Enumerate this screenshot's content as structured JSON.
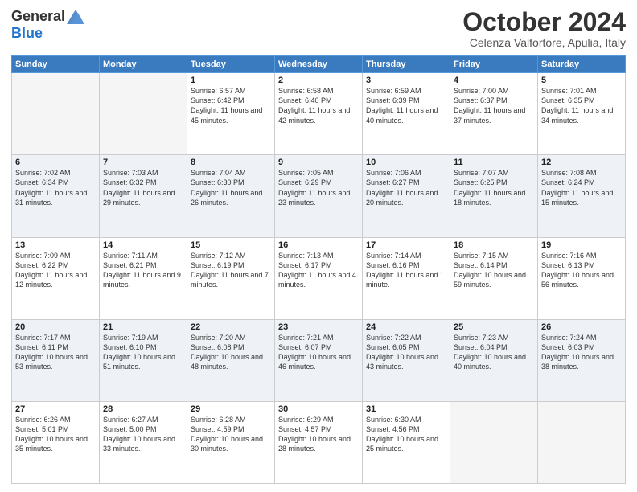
{
  "header": {
    "logo_general": "General",
    "logo_blue": "Blue",
    "month_title": "October 2024",
    "subtitle": "Celenza Valfortore, Apulia, Italy"
  },
  "days_of_week": [
    "Sunday",
    "Monday",
    "Tuesday",
    "Wednesday",
    "Thursday",
    "Friday",
    "Saturday"
  ],
  "weeks": [
    [
      {
        "day": "",
        "sunrise": "",
        "sunset": "",
        "daylight": "",
        "empty": true
      },
      {
        "day": "",
        "sunrise": "",
        "sunset": "",
        "daylight": "",
        "empty": true
      },
      {
        "day": "1",
        "sunrise": "Sunrise: 6:57 AM",
        "sunset": "Sunset: 6:42 PM",
        "daylight": "Daylight: 11 hours and 45 minutes."
      },
      {
        "day": "2",
        "sunrise": "Sunrise: 6:58 AM",
        "sunset": "Sunset: 6:40 PM",
        "daylight": "Daylight: 11 hours and 42 minutes."
      },
      {
        "day": "3",
        "sunrise": "Sunrise: 6:59 AM",
        "sunset": "Sunset: 6:39 PM",
        "daylight": "Daylight: 11 hours and 40 minutes."
      },
      {
        "day": "4",
        "sunrise": "Sunrise: 7:00 AM",
        "sunset": "Sunset: 6:37 PM",
        "daylight": "Daylight: 11 hours and 37 minutes."
      },
      {
        "day": "5",
        "sunrise": "Sunrise: 7:01 AM",
        "sunset": "Sunset: 6:35 PM",
        "daylight": "Daylight: 11 hours and 34 minutes."
      }
    ],
    [
      {
        "day": "6",
        "sunrise": "Sunrise: 7:02 AM",
        "sunset": "Sunset: 6:34 PM",
        "daylight": "Daylight: 11 hours and 31 minutes."
      },
      {
        "day": "7",
        "sunrise": "Sunrise: 7:03 AM",
        "sunset": "Sunset: 6:32 PM",
        "daylight": "Daylight: 11 hours and 29 minutes."
      },
      {
        "day": "8",
        "sunrise": "Sunrise: 7:04 AM",
        "sunset": "Sunset: 6:30 PM",
        "daylight": "Daylight: 11 hours and 26 minutes."
      },
      {
        "day": "9",
        "sunrise": "Sunrise: 7:05 AM",
        "sunset": "Sunset: 6:29 PM",
        "daylight": "Daylight: 11 hours and 23 minutes."
      },
      {
        "day": "10",
        "sunrise": "Sunrise: 7:06 AM",
        "sunset": "Sunset: 6:27 PM",
        "daylight": "Daylight: 11 hours and 20 minutes."
      },
      {
        "day": "11",
        "sunrise": "Sunrise: 7:07 AM",
        "sunset": "Sunset: 6:25 PM",
        "daylight": "Daylight: 11 hours and 18 minutes."
      },
      {
        "day": "12",
        "sunrise": "Sunrise: 7:08 AM",
        "sunset": "Sunset: 6:24 PM",
        "daylight": "Daylight: 11 hours and 15 minutes."
      }
    ],
    [
      {
        "day": "13",
        "sunrise": "Sunrise: 7:09 AM",
        "sunset": "Sunset: 6:22 PM",
        "daylight": "Daylight: 11 hours and 12 minutes."
      },
      {
        "day": "14",
        "sunrise": "Sunrise: 7:11 AM",
        "sunset": "Sunset: 6:21 PM",
        "daylight": "Daylight: 11 hours and 9 minutes."
      },
      {
        "day": "15",
        "sunrise": "Sunrise: 7:12 AM",
        "sunset": "Sunset: 6:19 PM",
        "daylight": "Daylight: 11 hours and 7 minutes."
      },
      {
        "day": "16",
        "sunrise": "Sunrise: 7:13 AM",
        "sunset": "Sunset: 6:17 PM",
        "daylight": "Daylight: 11 hours and 4 minutes."
      },
      {
        "day": "17",
        "sunrise": "Sunrise: 7:14 AM",
        "sunset": "Sunset: 6:16 PM",
        "daylight": "Daylight: 11 hours and 1 minute."
      },
      {
        "day": "18",
        "sunrise": "Sunrise: 7:15 AM",
        "sunset": "Sunset: 6:14 PM",
        "daylight": "Daylight: 10 hours and 59 minutes."
      },
      {
        "day": "19",
        "sunrise": "Sunrise: 7:16 AM",
        "sunset": "Sunset: 6:13 PM",
        "daylight": "Daylight: 10 hours and 56 minutes."
      }
    ],
    [
      {
        "day": "20",
        "sunrise": "Sunrise: 7:17 AM",
        "sunset": "Sunset: 6:11 PM",
        "daylight": "Daylight: 10 hours and 53 minutes."
      },
      {
        "day": "21",
        "sunrise": "Sunrise: 7:19 AM",
        "sunset": "Sunset: 6:10 PM",
        "daylight": "Daylight: 10 hours and 51 minutes."
      },
      {
        "day": "22",
        "sunrise": "Sunrise: 7:20 AM",
        "sunset": "Sunset: 6:08 PM",
        "daylight": "Daylight: 10 hours and 48 minutes."
      },
      {
        "day": "23",
        "sunrise": "Sunrise: 7:21 AM",
        "sunset": "Sunset: 6:07 PM",
        "daylight": "Daylight: 10 hours and 46 minutes."
      },
      {
        "day": "24",
        "sunrise": "Sunrise: 7:22 AM",
        "sunset": "Sunset: 6:05 PM",
        "daylight": "Daylight: 10 hours and 43 minutes."
      },
      {
        "day": "25",
        "sunrise": "Sunrise: 7:23 AM",
        "sunset": "Sunset: 6:04 PM",
        "daylight": "Daylight: 10 hours and 40 minutes."
      },
      {
        "day": "26",
        "sunrise": "Sunrise: 7:24 AM",
        "sunset": "Sunset: 6:03 PM",
        "daylight": "Daylight: 10 hours and 38 minutes."
      }
    ],
    [
      {
        "day": "27",
        "sunrise": "Sunrise: 6:26 AM",
        "sunset": "Sunset: 5:01 PM",
        "daylight": "Daylight: 10 hours and 35 minutes."
      },
      {
        "day": "28",
        "sunrise": "Sunrise: 6:27 AM",
        "sunset": "Sunset: 5:00 PM",
        "daylight": "Daylight: 10 hours and 33 minutes."
      },
      {
        "day": "29",
        "sunrise": "Sunrise: 6:28 AM",
        "sunset": "Sunset: 4:59 PM",
        "daylight": "Daylight: 10 hours and 30 minutes."
      },
      {
        "day": "30",
        "sunrise": "Sunrise: 6:29 AM",
        "sunset": "Sunset: 4:57 PM",
        "daylight": "Daylight: 10 hours and 28 minutes."
      },
      {
        "day": "31",
        "sunrise": "Sunrise: 6:30 AM",
        "sunset": "Sunset: 4:56 PM",
        "daylight": "Daylight: 10 hours and 25 minutes."
      },
      {
        "day": "",
        "sunrise": "",
        "sunset": "",
        "daylight": "",
        "empty": true
      },
      {
        "day": "",
        "sunrise": "",
        "sunset": "",
        "daylight": "",
        "empty": true
      }
    ]
  ]
}
